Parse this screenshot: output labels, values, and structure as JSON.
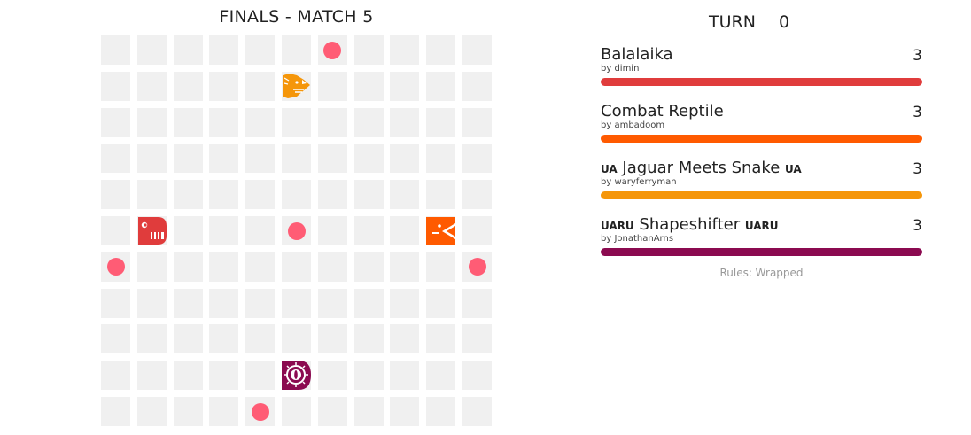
{
  "board": {
    "title": "FINALS - MATCH 5",
    "size": 11,
    "food": [
      [
        6,
        0
      ],
      [
        5,
        5
      ],
      [
        0,
        6
      ],
      [
        10,
        6
      ],
      [
        4,
        10
      ]
    ],
    "snakes": [
      {
        "name": "Balalaika",
        "color": "#e03c3c",
        "head": [
          1,
          5
        ],
        "facing": "right",
        "icon": "balalaika-snake-icon"
      },
      {
        "name": "Combat Reptile",
        "color": "#ff5a00",
        "head": [
          9,
          5
        ],
        "facing": "left",
        "icon": "combat-reptile-snake-icon"
      },
      {
        "name": "Jaguar Meets Snake",
        "color": "#f5960a",
        "head": [
          5,
          1
        ],
        "facing": "right",
        "icon": "jaguar-snake-icon"
      },
      {
        "name": "Shapeshifter",
        "color": "#8b0a50",
        "head": [
          5,
          9
        ],
        "facing": "right",
        "icon": "shapeshifter-snake-icon"
      }
    ]
  },
  "turn": {
    "label": "TURN",
    "value": "0"
  },
  "scoreboard": [
    {
      "prefix": "",
      "name": "Balalaika",
      "suffix": "",
      "author": "by dimin",
      "length": "3",
      "color": "#e03c3c",
      "health": 1.0
    },
    {
      "prefix": "",
      "name": "Combat Reptile",
      "suffix": "",
      "author": "by ambadoom",
      "length": "3",
      "color": "#ff5a00",
      "health": 1.0
    },
    {
      "prefix": "UA",
      "name": "Jaguar Meets Snake",
      "suffix": "UA",
      "author": "by waryferryman",
      "length": "3",
      "color": "#f5960a",
      "health": 1.0
    },
    {
      "prefix": "UARU",
      "name": "Shapeshifter",
      "suffix": "UARU",
      "author": "by JonathanArns",
      "length": "3",
      "color": "#8b0a50",
      "health": 1.0
    }
  ],
  "rules": "Rules: Wrapped"
}
